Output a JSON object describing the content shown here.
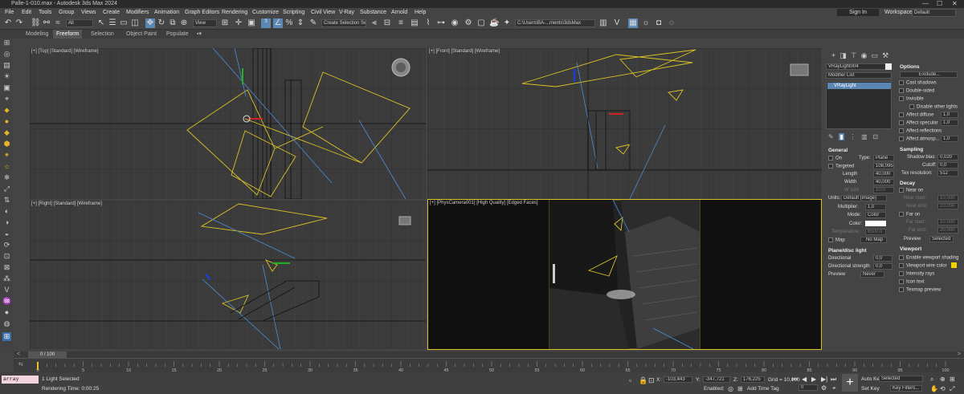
{
  "window": {
    "title": "Palle-1-010.max - Autodesk 3ds Max 2024",
    "controls": [
      "—",
      "☐",
      "✕"
    ]
  },
  "menu": {
    "items": [
      "File",
      "Edit",
      "Tools",
      "Group",
      "Views",
      "Create",
      "Modifiers",
      "Animation",
      "Graph Editors",
      "Rendering",
      "Customize",
      "Scripting",
      "Civil View",
      "V-Ray",
      "Substance",
      "Arnold",
      "Help"
    ],
    "sign_in": "Sign In",
    "workspaces_label": "Workspaces:",
    "workspaces_value": "Default"
  },
  "toolbar": {
    "filter_value": "All",
    "view_value": "View",
    "selection_set_placeholder": "Create Selection Se",
    "path_value": "C:\\Users\\BA-...ments\\3dsMax"
  },
  "ribbon": {
    "tabs": [
      "Modeling",
      "Freeform",
      "Selection",
      "Object Paint",
      "Populate"
    ],
    "active": "Freeform"
  },
  "viewports": {
    "top": "[+] [Top] [Standard] [Wireframe]",
    "front": "[+] [Front] [Standard] [Wireframe]",
    "right": "[+] [Right] [Standard] [Wireframe]",
    "camera": "[+] [PhysCamera001] [High Quality] [Edged Faces]"
  },
  "command_panel": {
    "object_name": "VRayLight004",
    "modifier_list": "Modifier List",
    "stack_item": "VRayLight",
    "general": {
      "title": "General",
      "on_label": "On",
      "type_label": "Type:",
      "type_value": "Plane",
      "targeted_label": "Targeted",
      "targeted_value": "108,095",
      "length_label": "Length",
      "length_value": "40,000",
      "width_label": "Width",
      "width_value": "40,000",
      "wsize_label": "W size",
      "wsize_value": "10,0",
      "units_label": "Units:",
      "units_value": "Default (image)",
      "multiplier_label": "Multiplier:",
      "multiplier_value": "1,0",
      "mode_label": "Mode:",
      "mode_value": "Color",
      "color_label": "Color:",
      "temperature_label": "Temperature:",
      "temperature_value": "6500,0",
      "map_label": "Map",
      "map_value": "No Map"
    },
    "plane_disc": {
      "title": "Plane/disc light",
      "directional_label": "Directional",
      "directional_value": "0,0",
      "dir_strength_label": "Directional strength",
      "dir_strength_value": "0,0",
      "preview_label": "Preview",
      "preview_value": "Never"
    },
    "options": {
      "title": "Options",
      "exclude": "Exclude...",
      "items": [
        "Cast shadows",
        "Double-sided",
        "Invisible",
        "Disable other lights",
        "Affect diffuse",
        "Affect specular",
        "Affect reflections",
        "Affect atmosp..."
      ],
      "checked": [
        true,
        false,
        true,
        false,
        true,
        true,
        true,
        true
      ],
      "values": [
        "",
        "",
        "",
        "",
        "1,0",
        "1,0",
        "",
        "1,0"
      ]
    },
    "sampling": {
      "title": "Sampling",
      "shadow_bias_label": "Shadow bias:",
      "shadow_bias_value": "0,020",
      "cutoff_label": "Cutoff:",
      "cutoff_value": "0,0",
      "tex_res_label": "Tex resolution:",
      "tex_res_value": "512"
    },
    "decay": {
      "title": "Decay",
      "near_on": "Near on",
      "near_start_label": "Near start:",
      "near_start_value": "10,000",
      "near_end_label": "Near end:",
      "near_end_value": "10,000",
      "far_on": "Far on",
      "far_start_label": "Far start:",
      "far_start_value": "10,000",
      "far_end_label": "Far end:",
      "far_end_value": "20,000",
      "preview_label": "Preview",
      "preview_value": "Selected"
    },
    "viewport": {
      "title": "Viewport",
      "enable_shading": "Enable viewport shading",
      "wire_color": "Viewport wire color",
      "intensity_rays": "Intensity rays",
      "icon_text": "Icon text",
      "texmap_preview": "Texmap preview"
    }
  },
  "timeline": {
    "frame": "0 / 100",
    "ticks": [
      "0",
      "5",
      "10",
      "15",
      "20",
      "25",
      "30",
      "35",
      "40",
      "45",
      "50",
      "55",
      "60",
      "65",
      "70",
      "75",
      "80",
      "85",
      "90",
      "95",
      "100"
    ],
    "progress": 0.0
  },
  "status": {
    "maxscript": "array modifi",
    "selected": "1 Light Selected",
    "render_time": "Rendering Time: 0:00:25",
    "x_label": "X:",
    "x_value": "-103,443",
    "y_label": "Y:",
    "y_value": "-347,721",
    "z_label": "Z:",
    "z_value": "176,225",
    "grid": "Grid = 10,000",
    "enabled": "Enabled:",
    "add_time_tag": "Add Time Tag",
    "auto_key": "Auto Key",
    "selected_dd": "Selected",
    "set_key": "Set Key",
    "key_filters": "Key Filters...",
    "frame_value": "0"
  },
  "colors": {
    "light_wire": "#d9c224",
    "camera_ray": "#4a8fd6",
    "accent": "#5b87b5"
  }
}
